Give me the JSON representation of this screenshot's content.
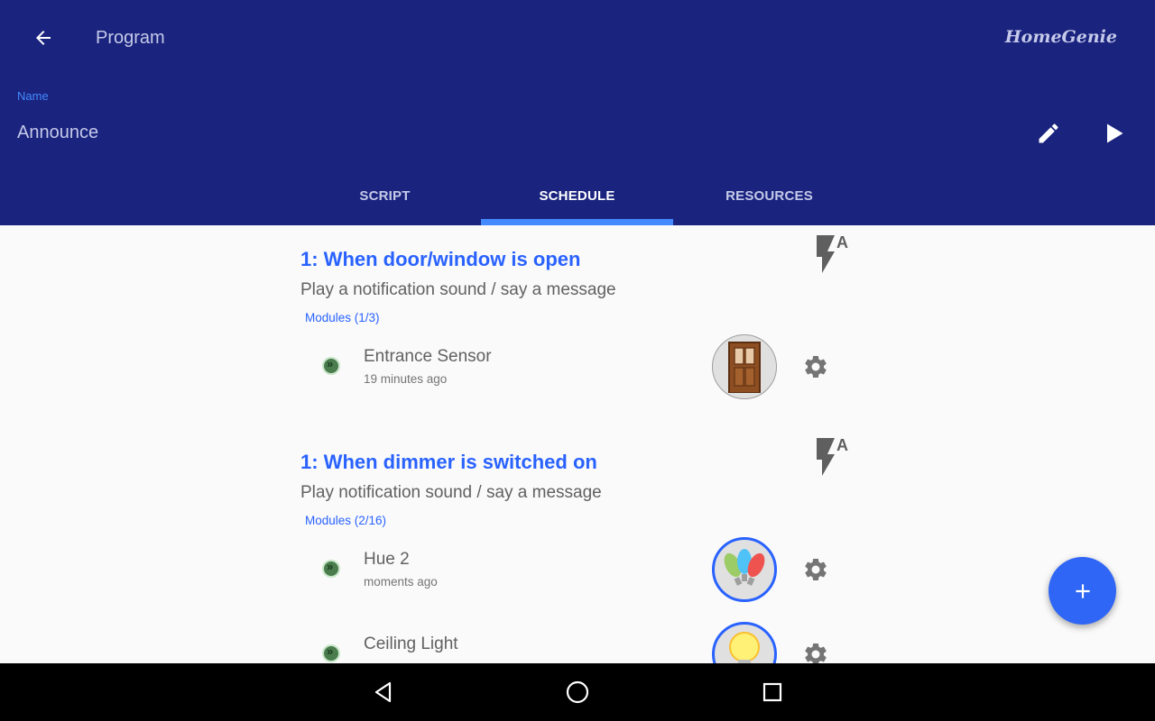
{
  "header": {
    "title": "Program",
    "brand": "HomeGenie",
    "name_label": "Name",
    "name_value": "Announce"
  },
  "tabs": [
    {
      "label": "SCRIPT",
      "active": false
    },
    {
      "label": "SCHEDULE",
      "active": true
    },
    {
      "label": "RESOURCES",
      "active": false
    }
  ],
  "schedules": [
    {
      "title": "1: When door/window is open",
      "description": "Play a notification sound / say a message",
      "modules_label": "Modules (1/3)",
      "modules": [
        {
          "name": "Entrance Sensor",
          "time": "19 minutes ago",
          "icon": "door-icon",
          "selected": false
        }
      ]
    },
    {
      "title": "1: When dimmer is switched on",
      "description": "Play notification sound / say a message",
      "modules_label": "Modules (2/16)",
      "modules": [
        {
          "name": "Hue 2",
          "time": "moments ago",
          "icon": "colored-bulbs-icon",
          "selected": true
        },
        {
          "name": "Ceiling Light",
          "time": "",
          "icon": "light-bulb-icon",
          "selected": true
        }
      ]
    }
  ],
  "colors": {
    "appbar": "#1a237e",
    "accent": "#448aff",
    "title_blue": "#2962ff",
    "fab": "#2f66f5"
  }
}
